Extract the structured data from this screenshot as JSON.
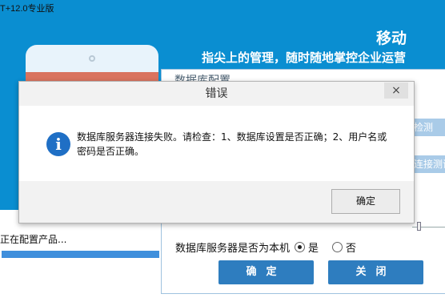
{
  "app": {
    "title": "T+12.0专业版"
  },
  "banner": {
    "title": "移动",
    "subtitle": "指尖上的管理，随时随地掌控企业运营"
  },
  "progress": {
    "label": "正在配置产品...",
    "fraction": 1.0
  },
  "db_window": {
    "title": "数据库配置",
    "detect_label": "检测",
    "test_connection_label": "连接测试",
    "local_question": "数据库服务器是否为本机",
    "options": [
      {
        "label": "是",
        "selected": true
      },
      {
        "label": "否",
        "selected": false
      }
    ],
    "confirm_label": "确定",
    "close_label": "关闭"
  },
  "dialog": {
    "title": "错误",
    "close_symbol": "×",
    "icon": "info-icon",
    "message": "数据库服务器连接失败。请检查：1、数据库设置是否正确；2、用户名或密码是否正确。",
    "ok_label": "确定"
  },
  "colors": {
    "banner": "#0a8ed1",
    "button": "#2e7dbf",
    "info": "#1f6fc5"
  }
}
